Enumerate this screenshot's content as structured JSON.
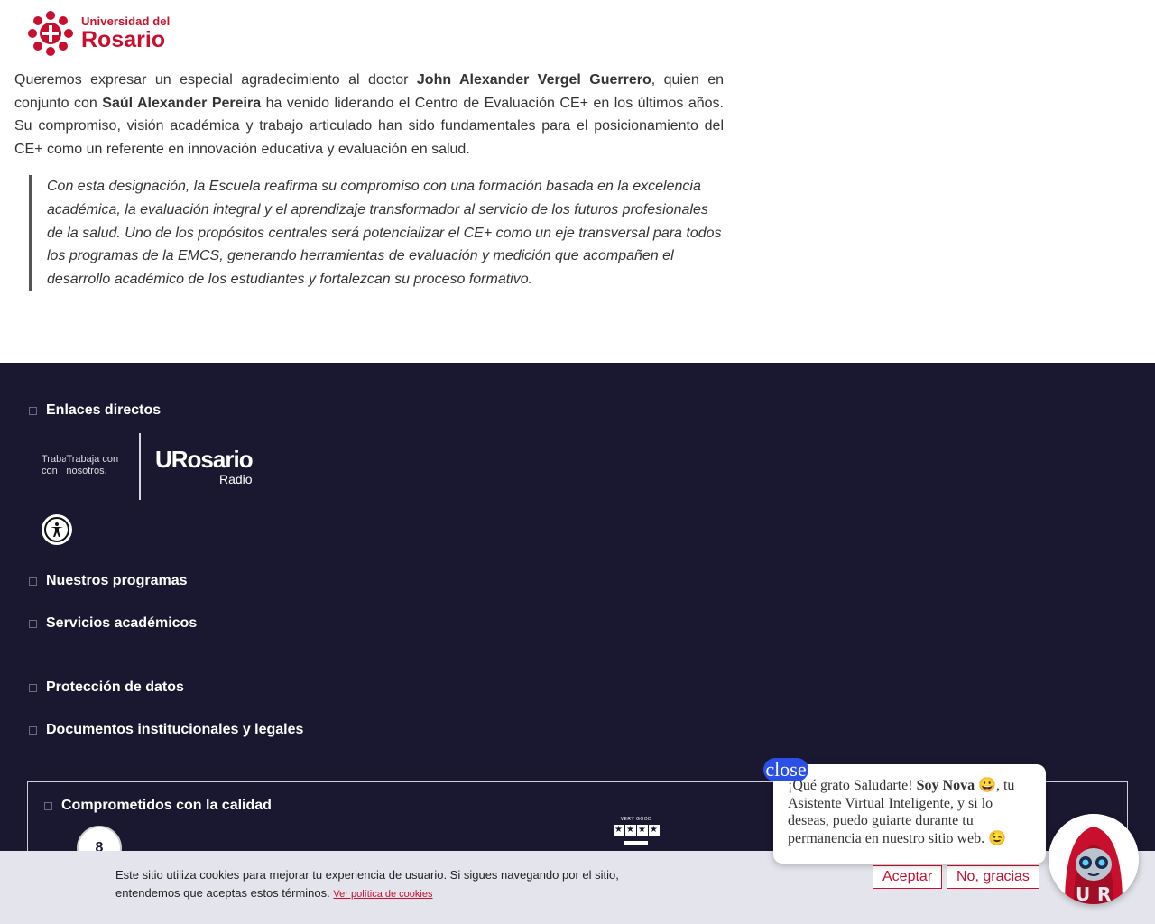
{
  "header": {
    "logo_line1": "Universidad del",
    "logo_line2": "Rosario"
  },
  "article": {
    "p1_a": "Queremos expresar un especial agradecimiento al doctor ",
    "p1_name1": "John Alexander Vergel Guerrero",
    "p1_b": ", quien en conjunto con ",
    "p1_name2": "Saúl Alexander Pereira",
    "p1_c": " ha venido liderando el Centro de Evaluación CE+ en los últimos años. Su compromiso, visión académica y trabajo articulado han sido fundamentales para el posicionamiento del CE+ como un referente en innovación educativa y evaluación en salud.",
    "quote": "Con esta designación, la Escuela reafirma su compromiso con una formación basada en la excelencia académica, la evaluación integral y el aprendizaje transformador al servicio de los futuros profesionales de la salud. Uno de los propósitos centrales será potencializar el CE+ como un eje transversal para todos los programas de la EMCS, generando herramientas de evaluación y medición que acompañen el desarrollo académico de los estudiantes y fortalezcan su proceso formativo."
  },
  "footer": {
    "sections": {
      "direct_links": "Enlaces directos",
      "programs": "Nuestros programas",
      "academic": "Servicios académicos",
      "data_protection": "Protección de datos",
      "documents": "Documentos institucionales y legales",
      "quality": "Comprometidos con la calidad"
    },
    "work_link_alt": "Trabaja con",
    "work_link_text": "Trabaja con nosotros.",
    "radio_logo_main": "URosario",
    "radio_logo_sub": "Radio",
    "seal_text": "8",
    "stars_label": "VERY GOOD"
  },
  "cookie": {
    "text": "Este sitio utiliza cookies para mejorar tu experiencia de usuario. Si sigues navegando por el sitio, entendemos que aceptas estos términos.",
    "policy_link": "Ver política de cookies",
    "accept": "Aceptar",
    "decline": "No, gracias"
  },
  "chat": {
    "close_label": "close",
    "msg_a": "¡Qué grato Saludarte! ",
    "msg_name": "Soy Nova",
    "msg_b": " 😀, tu Asistente Virtual Inteligente, y si lo deseas, puedo guiarte durante tu permanencia en nuestro sitio web. 😉"
  },
  "colors": {
    "brand_red": "#c8102e",
    "footer_bg": "#1a1730",
    "close_blue": "#2a50e8"
  }
}
